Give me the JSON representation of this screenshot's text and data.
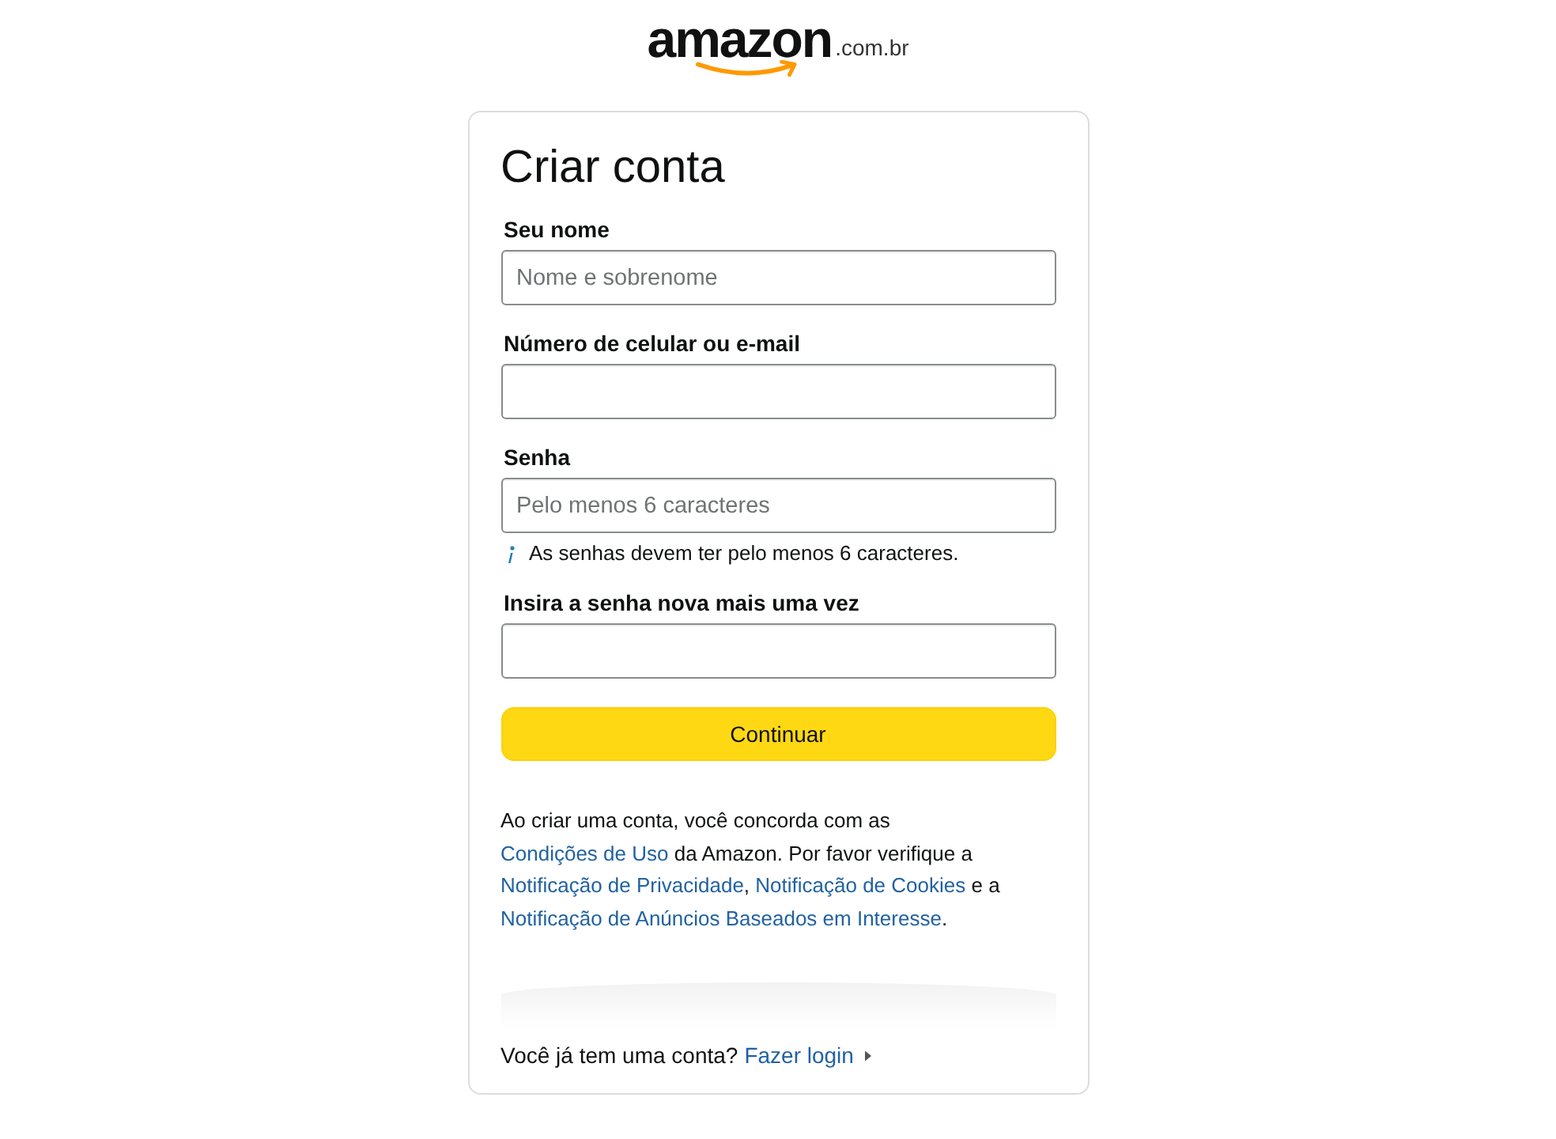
{
  "logo": {
    "wordmark": "amazon",
    "suffix": ".com.br"
  },
  "title": "Criar conta",
  "fields": [
    {
      "label": "Seu nome",
      "placeholder": "Nome e sobrenome"
    },
    {
      "label": "Número de celular ou e-mail"
    },
    {
      "label": "Senha",
      "placeholder": "Pelo menos 6 caracteres",
      "hint": "As senhas devem ter pelo menos 6 caracteres."
    },
    {
      "label": "Insira a senha nova mais uma vez"
    }
  ],
  "submit_button": "Continuar",
  "legal": [
    {
      "text": "Ao criar uma conta, você concorda com as ",
      "link": false
    },
    {
      "text": "Condições de Uso",
      "link": true
    },
    {
      "text": " da Amazon. Por favor verifique a ",
      "link": false
    },
    {
      "text": "Notificação de Privacidade",
      "link": true
    },
    {
      "text": ", ",
      "link": false
    },
    {
      "text": "Notificação de Cookies",
      "link": true
    },
    {
      "text": " e a ",
      "link": false
    },
    {
      "text": "Notificação de Anúncios Baseados em Interesse",
      "link": true
    },
    {
      "text": ".",
      "link": false
    }
  ],
  "signin": {
    "prompt": "Você já tem uma conta?",
    "link": "Fazer login"
  }
}
